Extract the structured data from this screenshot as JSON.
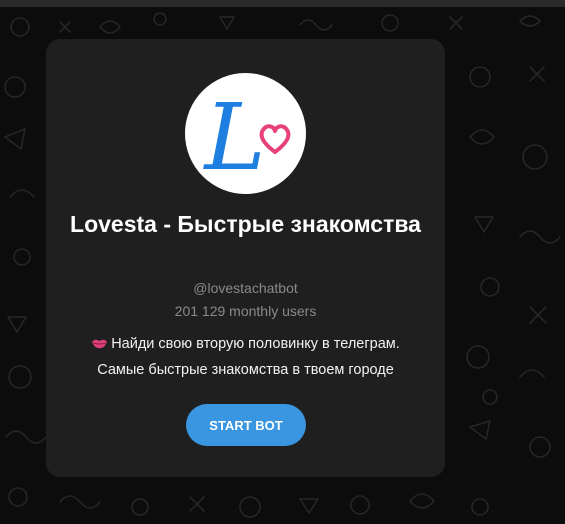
{
  "bot": {
    "title": "Lovesta - Быстрые знакомства",
    "username": "@lovestachatbot",
    "monthly_users": "201 129 monthly users",
    "description_line1": "Найди свою вторую половинку в телеграм.",
    "description_line2": "Самые быстрые знакомства в твоем городе",
    "start_label": "START BOT",
    "avatar_letter": "L"
  },
  "colors": {
    "background": "#0c0c0c",
    "card": "#1f1f1f",
    "button": "#3a96e0",
    "logo_blue": "#1f7fe0",
    "logo_pink": "#e8407a"
  },
  "icons": {
    "description_emoji": "kiss-lips-icon",
    "avatar_heart": "heart-icon"
  }
}
